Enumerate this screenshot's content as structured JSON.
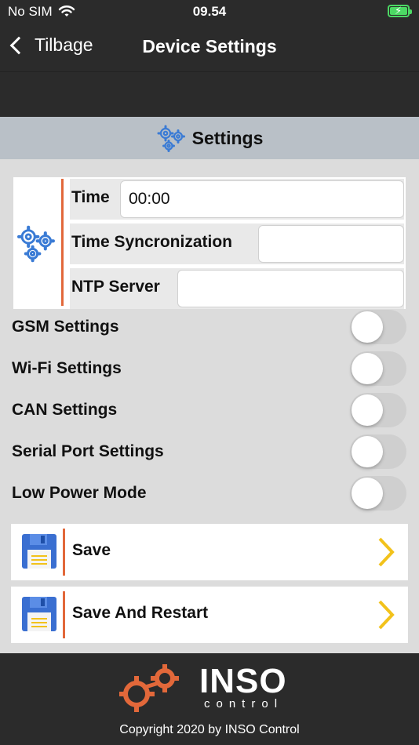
{
  "status_bar": {
    "carrier": "No SIM",
    "time": "09.54",
    "battery_charging": true
  },
  "nav": {
    "back_label": "Tilbage",
    "title": "Device Settings"
  },
  "section": {
    "title": "Settings"
  },
  "time_settings": {
    "time": {
      "label": "Time",
      "value": "00:00"
    },
    "sync": {
      "label": "Time Syncronization",
      "value": ""
    },
    "ntp": {
      "label": "NTP Server",
      "value": ""
    }
  },
  "toggles": [
    {
      "label": "GSM Settings",
      "on": false
    },
    {
      "label": "Wi-Fi Settings",
      "on": false
    },
    {
      "label": "CAN Settings",
      "on": false
    },
    {
      "label": "Serial Port Settings",
      "on": false
    },
    {
      "label": "Low Power Mode",
      "on": false
    }
  ],
  "actions": {
    "save": "Save",
    "save_restart": "Save And Restart"
  },
  "footer": {
    "logo_main": "INSO",
    "logo_sub": "control",
    "copyright": "Copyright 2020 by INSO Control"
  },
  "colors": {
    "accent": "#e2683a",
    "gear_blue": "#3a7bd5",
    "chevron": "#f2c21b",
    "header_bg": "#b9c0c7"
  }
}
